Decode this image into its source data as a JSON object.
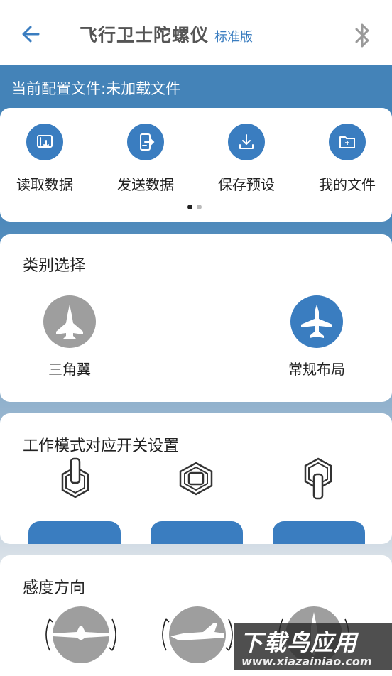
{
  "header": {
    "title": "飞行卫士陀螺仪",
    "edition": "标准版",
    "back_icon": "back-arrow-icon",
    "bluetooth_icon": "bluetooth-icon"
  },
  "config": {
    "label": "当前配置文件:未加载文件"
  },
  "actions": [
    {
      "label": "读取数据",
      "icon": "read-data-icon"
    },
    {
      "label": "发送数据",
      "icon": "send-data-icon"
    },
    {
      "label": "保存预设",
      "icon": "save-preset-icon"
    },
    {
      "label": "我的文件",
      "icon": "my-files-icon"
    }
  ],
  "pager": {
    "pages": 2,
    "current": 1
  },
  "category": {
    "title": "类别选择",
    "options": [
      {
        "label": "三角翼",
        "selected": false
      },
      {
        "label": "常规布局",
        "selected": true
      }
    ]
  },
  "mode": {
    "title": "工作模式对应开关设置"
  },
  "sense": {
    "title": "感度方向"
  },
  "watermark": {
    "main": "下载鸟应用",
    "sub": "www.xiazainiao.com"
  },
  "colors": {
    "accent": "#3a7dc0",
    "header_bar": "#4483b8",
    "inactive": "#9e9e9e"
  }
}
